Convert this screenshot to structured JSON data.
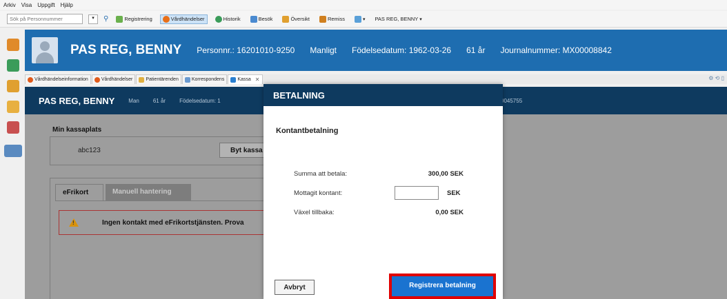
{
  "menu": [
    "Arkiv",
    "Visa",
    "Uppgift",
    "Hjälp"
  ],
  "toolbar": {
    "search_placeholder": "Sök på Personnummer",
    "items": [
      "Registrering",
      "Vårdhändelser",
      "Historik",
      "Besök",
      "Översikt",
      "Remiss"
    ],
    "patient_dropdown": "PAS REG, BENNY"
  },
  "header": {
    "name": "PAS REG, BENNY",
    "personnr": "Personnr.: 16201010-9250",
    "gender": "Manligt",
    "birthdate": "Födelsedatum: 1962-03-26",
    "age": "61 år",
    "journal": "Journalnummer: MX00008842"
  },
  "tabs": [
    "Vårdhändelseinformation",
    "Vårdhändelser",
    "Patientärenden",
    "Korrespondens",
    "Kassa"
  ],
  "patient_strip": {
    "name": "PAS REG, BENNY",
    "gender": "Man",
    "age": "61 år",
    "birth": "Födelsedatum: 1",
    "journal_tail": "0045755"
  },
  "kassa": {
    "label": "Min kassaplats",
    "value": "abc123",
    "button": "Byt kassa"
  },
  "subtabs": [
    "eFrikort",
    "Manuell hantering"
  ],
  "warning": "Ingen kontakt med eFrikortstjänsten. Prova",
  "modal": {
    "title": "BETALNING",
    "subtitle": "Kontantbetalning",
    "summa_label": "Summa att betala:",
    "summa_value": "300,00 SEK",
    "mottagit_label": "Mottagit kontant:",
    "mottagit_value": "",
    "unit": "SEK",
    "vaxel_label": "Växel tillbaka:",
    "vaxel_value": "0,00 SEK",
    "cancel": "Avbryt",
    "submit": "Registrera betalning"
  }
}
